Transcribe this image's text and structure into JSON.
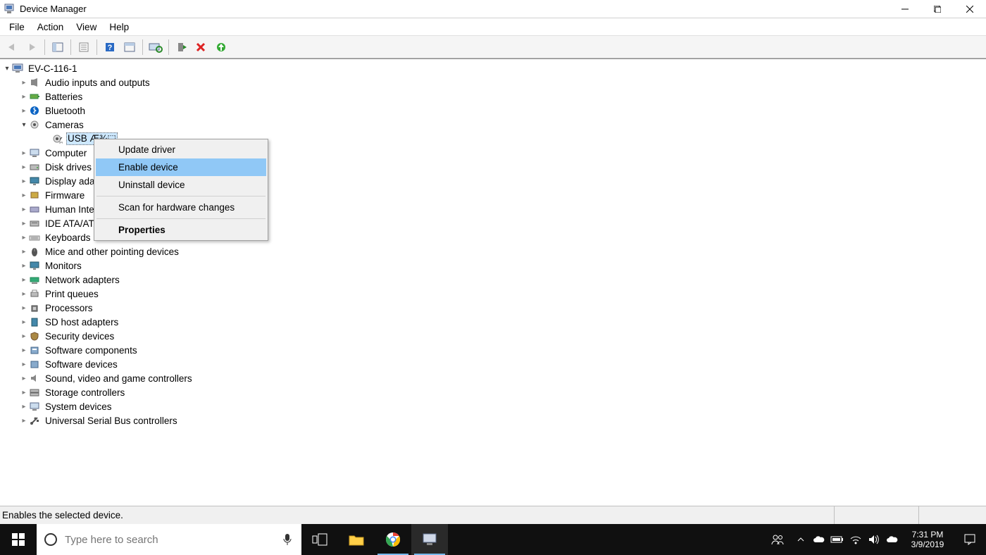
{
  "window": {
    "title": "Device Manager"
  },
  "menubar": [
    "File",
    "Action",
    "View",
    "Help"
  ],
  "tree": {
    "root": "EV-C-116-1",
    "categories": [
      {
        "label": "Audio inputs and outputs",
        "icon": "audio"
      },
      {
        "label": "Batteries",
        "icon": "battery"
      },
      {
        "label": "Bluetooth",
        "icon": "bluetooth"
      },
      {
        "label": "Cameras",
        "icon": "camera",
        "expanded": true
      },
      {
        "label": "Computer",
        "icon": "computer"
      },
      {
        "label": "Disk drives",
        "icon": "disk"
      },
      {
        "label": "Display adapters",
        "icon": "display",
        "truncated": "Display ad"
      },
      {
        "label": "Firmware",
        "icon": "firmware"
      },
      {
        "label": "Human Interface Devices",
        "icon": "hid",
        "truncated": "Human Int"
      },
      {
        "label": "IDE ATA/ATAPI controllers",
        "icon": "ide",
        "truncated": "IDE ATA/AT"
      },
      {
        "label": "Keyboards",
        "icon": "keyboard"
      },
      {
        "label": "Mice and other pointing devices",
        "icon": "mouse"
      },
      {
        "label": "Monitors",
        "icon": "monitor"
      },
      {
        "label": "Network adapters",
        "icon": "network"
      },
      {
        "label": "Print queues",
        "icon": "printer"
      },
      {
        "label": "Processors",
        "icon": "cpu"
      },
      {
        "label": "SD host adapters",
        "icon": "sd"
      },
      {
        "label": "Security devices",
        "icon": "security"
      },
      {
        "label": "Software components",
        "icon": "swcomp"
      },
      {
        "label": "Software devices",
        "icon": "swdev"
      },
      {
        "label": "Sound, video and game controllers",
        "icon": "sound"
      },
      {
        "label": "Storage controllers",
        "icon": "storage"
      },
      {
        "label": "System devices",
        "icon": "system"
      },
      {
        "label": "Universal Serial Bus controllers",
        "icon": "usb"
      }
    ],
    "camera_child": "USB Æ¾⬚"
  },
  "context_menu": {
    "items": [
      {
        "label": "Update driver"
      },
      {
        "label": "Enable device",
        "highlight": true
      },
      {
        "label": "Uninstall device"
      },
      {
        "sep": true
      },
      {
        "label": "Scan for hardware changes"
      },
      {
        "sep": true
      },
      {
        "label": "Properties",
        "bold": true
      }
    ]
  },
  "statusbar": {
    "text": "Enables the selected device."
  },
  "taskbar": {
    "search_placeholder": "Type here to search",
    "time": "7:31 PM",
    "date": "3/9/2019"
  }
}
